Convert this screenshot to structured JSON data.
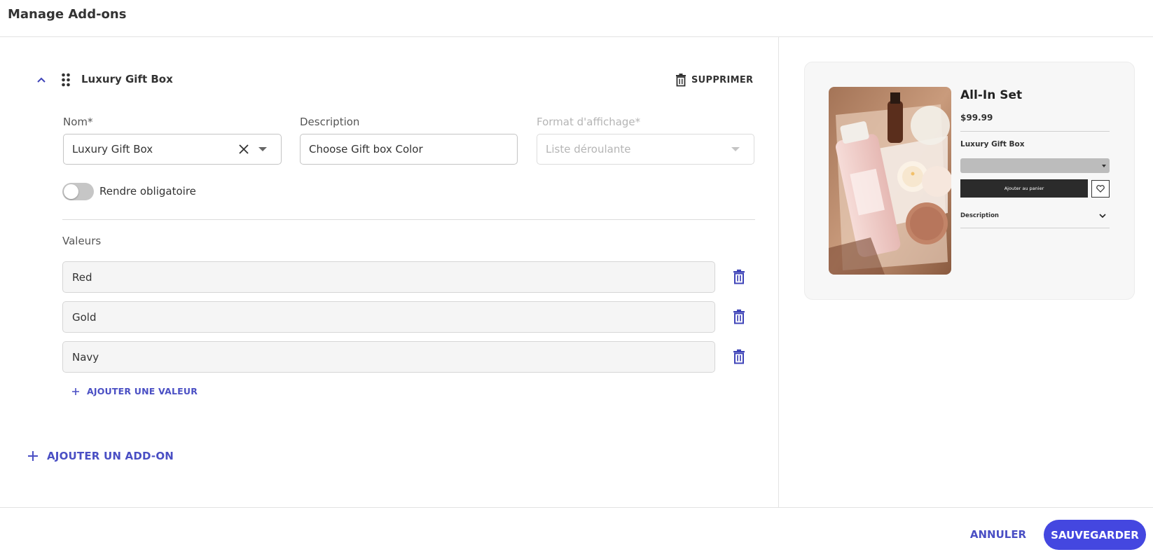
{
  "header": {
    "title": "Manage Add-ons"
  },
  "addon": {
    "title": "Luxury Gift Box",
    "delete_label": "SUPPRIMER",
    "fields": {
      "name": {
        "label": "Nom*",
        "value": "Luxury Gift Box"
      },
      "description": {
        "label": "Description",
        "value": "Choose Gift box Color"
      },
      "format": {
        "label": "Format d'affichage*",
        "placeholder": "Liste déroulante"
      }
    },
    "required_toggle": {
      "label": "Rendre obligatoire",
      "checked": false
    },
    "values_label": "Valeurs",
    "values": [
      "Red",
      "Gold",
      "Navy"
    ],
    "add_value_label": "AJOUTER UNE VALEUR"
  },
  "add_addon_label": "AJOUTER UN ADD-ON",
  "footer": {
    "cancel_label": "ANNULER",
    "save_label": "SAUVEGARDER"
  },
  "preview": {
    "product_title": "All-In Set",
    "price": "$99.99",
    "addon_label": "Luxury Gift Box",
    "cart_button": "Ajouter au panier",
    "description_label": "Description"
  },
  "colors": {
    "accent": "#4447e0",
    "link": "#4a4fc4",
    "trash": "#3f44b8"
  },
  "icons": [
    "chevron-up-icon",
    "drag-handle-icon",
    "trash-icon",
    "close-icon",
    "dropdown-arrow-icon",
    "plus-icon",
    "heart-icon",
    "chevron-down-icon"
  ]
}
